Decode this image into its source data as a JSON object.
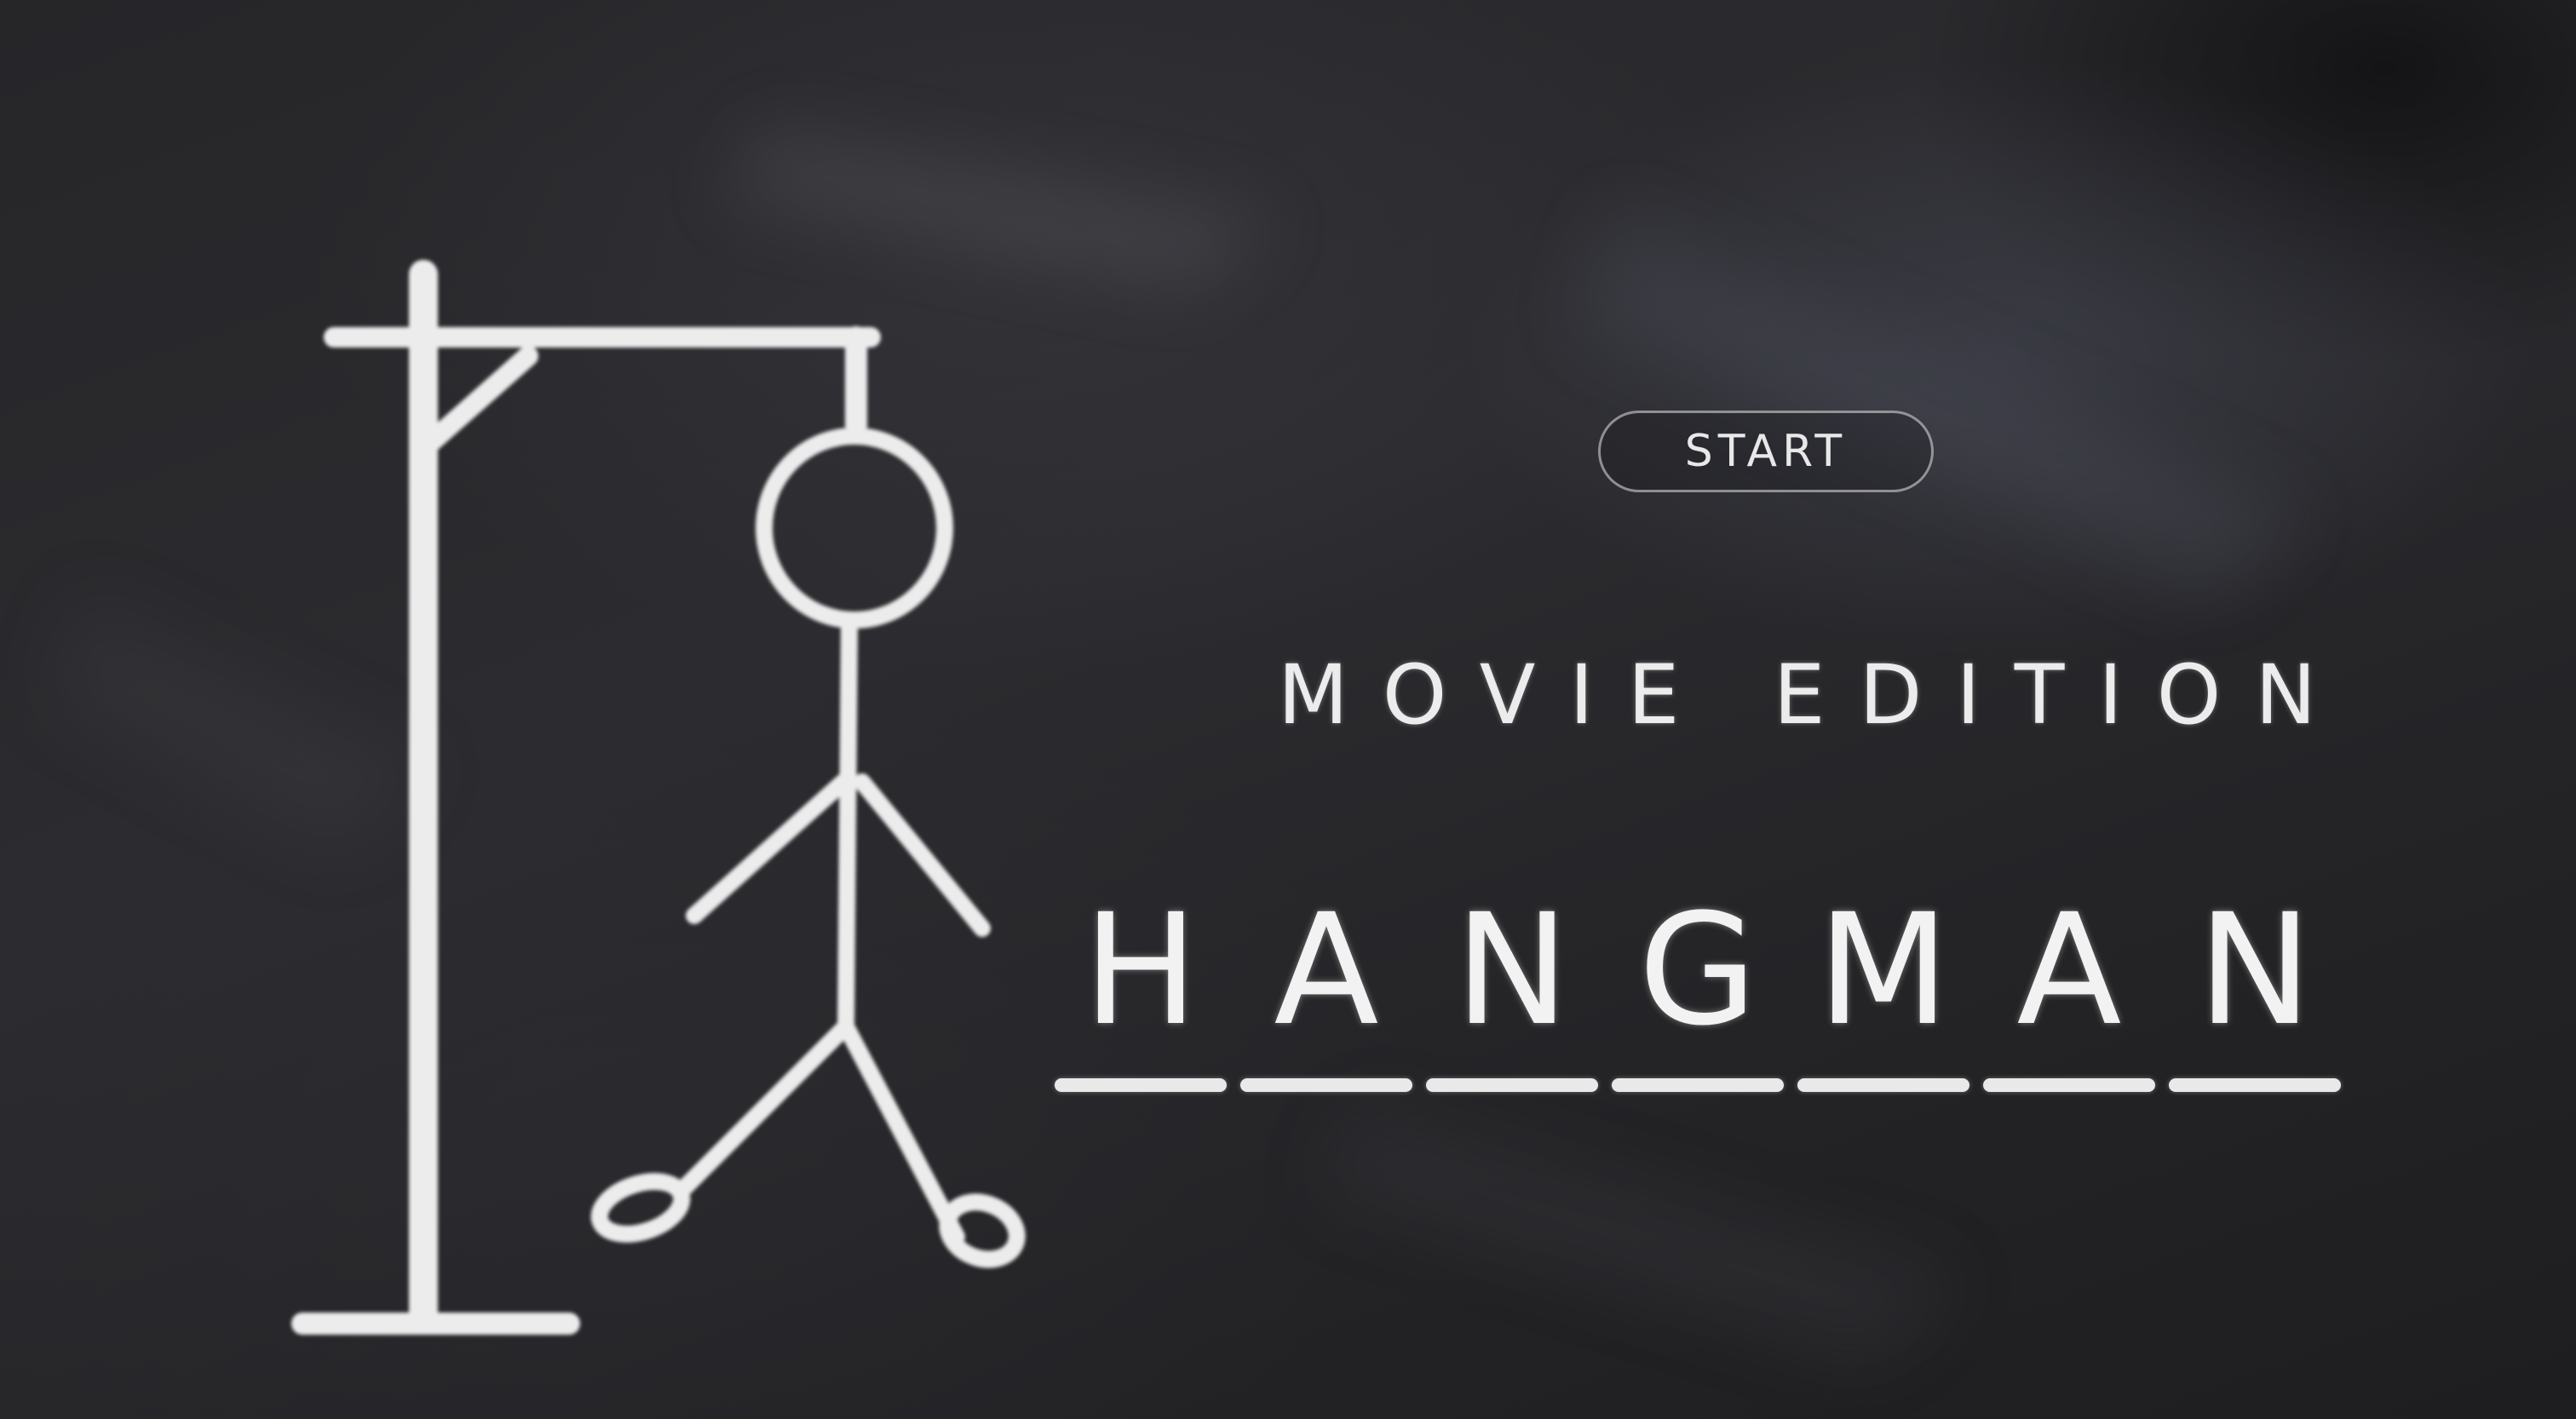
{
  "game": {
    "subtitle": "MOVIE EDITION",
    "start_button_label": "START",
    "title_letters": [
      "H",
      "A",
      "N",
      "G",
      "M",
      "A",
      "N"
    ]
  },
  "style": {
    "chalk_color": "#eeeeee",
    "board_color": "#262629"
  },
  "illustration": {
    "gallows-icon": "gallows",
    "stick-figure-icon": "hanged stick figure"
  }
}
